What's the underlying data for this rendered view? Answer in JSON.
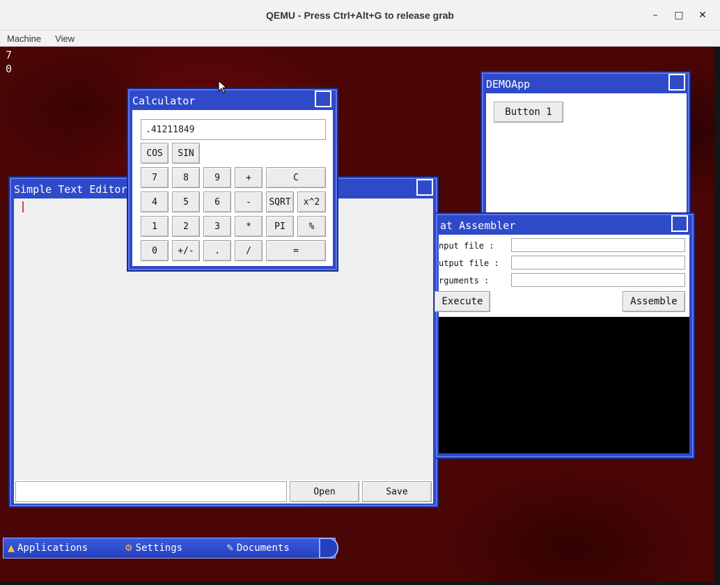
{
  "host": {
    "title": "QEMU - Press Ctrl+Alt+G to release grab",
    "minimize_icon": "minimize-icon",
    "maximize_icon": "maximize-icon",
    "close_icon": "close-icon",
    "menu": [
      "Machine",
      "View"
    ]
  },
  "console": [
    "7",
    "0"
  ],
  "calculator": {
    "title": "Calculator",
    "display": ".41211849",
    "func_buttons": [
      "COS",
      "SIN"
    ],
    "rows": [
      [
        "7",
        "8",
        "9",
        "+",
        "C"
      ],
      [
        "4",
        "5",
        "6",
        "-",
        "SQRT",
        "x^2"
      ],
      [
        "1",
        "2",
        "3",
        "*",
        "PI",
        "%"
      ],
      [
        "0",
        "+/-",
        ".",
        "/",
        "="
      ]
    ]
  },
  "demoapp": {
    "title": "DEMOApp",
    "button": "Button 1"
  },
  "editor": {
    "title": "Simple Text Editor",
    "filename_value": "",
    "open_label": "Open",
    "save_label": "Save"
  },
  "assembler": {
    "title": "at Assembler",
    "input_label": "nput file :",
    "output_label": "utput file :",
    "args_label": "rguments :",
    "input_value": "",
    "output_value": "",
    "args_value": "",
    "execute_label": "Execute",
    "assemble_label": "Assemble"
  },
  "taskbar": {
    "applications": "Applications",
    "settings": "Settings",
    "documents": "Documents",
    "applications_icon": "applications-icon",
    "settings_icon": "gear-icon",
    "documents_icon": "documents-icon"
  }
}
